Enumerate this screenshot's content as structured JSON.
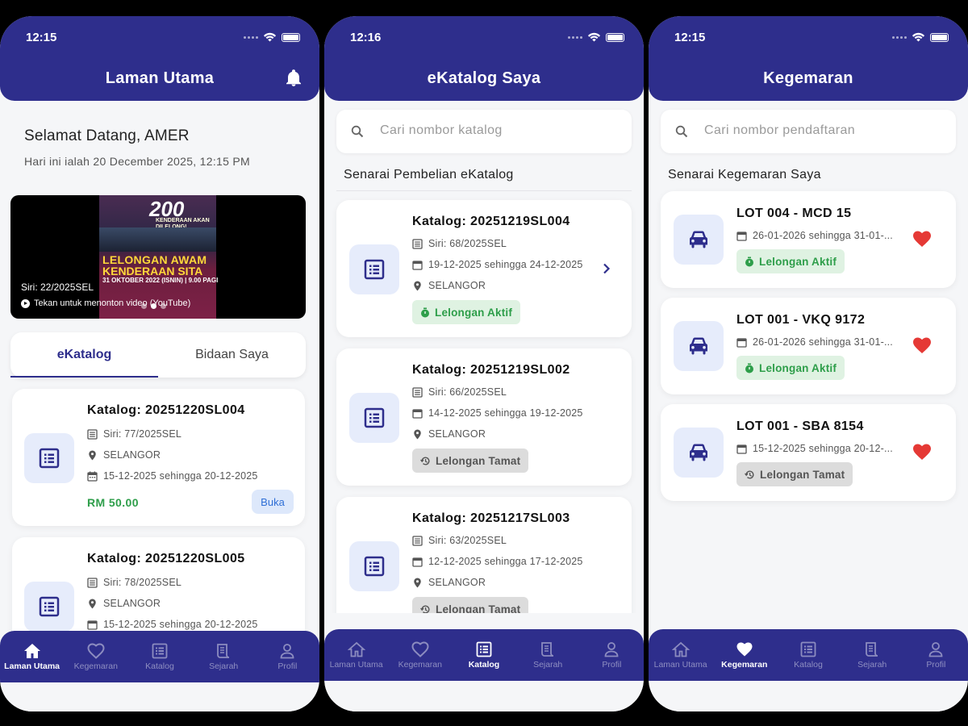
{
  "colors": {
    "primary": "#2e2e8c",
    "active_green": "#2e9e4a",
    "heart_red": "#e53935",
    "tile_bg": "#e6ecfb"
  },
  "home": {
    "status_time": "12:15",
    "title": "Laman Utama",
    "greeting": "Selamat Datang, AMER",
    "date_line": "Hari ini ialah 20 December 2025, 12:15 PM",
    "banner": {
      "poster_number": "200",
      "poster_tagline": "KENDERAAN AKAN DILELONG!",
      "poster_line1": "LELONGAN AWAM",
      "poster_line2": "KENDERAAN SITA",
      "poster_date": "31 OKTOBER 2022 (ISNIN) | 9.00 PAGI",
      "siri": "Siri: 22/2025SEL",
      "watch_text": "Tekan untuk menonton video (YouTube)"
    },
    "tabs": [
      "eKatalog",
      "Bidaan Saya"
    ],
    "cards": [
      {
        "title": "Katalog: 20251220SL004",
        "siri": "Siri: 77/2025SEL",
        "location": "SELANGOR",
        "dates": "15-12-2025 sehingga 20-12-2025",
        "price": "RM 50.00",
        "button": "Buka"
      },
      {
        "title": "Katalog: 20251220SL005",
        "siri": "Siri: 78/2025SEL",
        "location": "SELANGOR",
        "dates": "15-12-2025 sehingga 20-12-2025"
      }
    ]
  },
  "ekatalog": {
    "status_time": "12:16",
    "title": "eKatalog Saya",
    "search_placeholder": "Cari nombor katalog",
    "section_title": "Senarai Pembelian eKatalog",
    "cards": [
      {
        "title": "Katalog: 20251219SL004",
        "siri": "Siri: 68/2025SEL",
        "dates": "19-12-2025 sehingga 24-12-2025",
        "location": "SELANGOR",
        "status": "Lelongan Aktif"
      },
      {
        "title": "Katalog: 20251219SL002",
        "siri": "Siri: 66/2025SEL",
        "dates": "14-12-2025 sehingga 19-12-2025",
        "location": "SELANGOR",
        "status": "Lelongan Tamat"
      },
      {
        "title": "Katalog: 20251217SL003",
        "siri": "Siri: 63/2025SEL",
        "dates": "12-12-2025 sehingga 17-12-2025",
        "location": "SELANGOR",
        "status": "Lelongan Tamat"
      }
    ]
  },
  "kegemaran": {
    "status_time": "12:15",
    "title": "Kegemaran",
    "search_placeholder": "Cari nombor pendaftaran",
    "section_title": "Senarai Kegemaran Saya",
    "cards": [
      {
        "title": "LOT 004 - MCD 15",
        "dates": "26-01-2026 sehingga 31-01-...",
        "status": "Lelongan Aktif"
      },
      {
        "title": "LOT 001 - VKQ 9172",
        "dates": "26-01-2026 sehingga 31-01-...",
        "status": "Lelongan Aktif"
      },
      {
        "title": "LOT 001 - SBA 8154",
        "dates": "15-12-2025 sehingga 20-12-...",
        "status": "Lelongan Tamat"
      }
    ]
  },
  "nav": [
    "Laman Utama",
    "Kegemaran",
    "Katalog",
    "Sejarah",
    "Profil"
  ],
  "icons": [
    "home-icon",
    "heart-icon",
    "catalog-icon",
    "history-icon",
    "profile-icon",
    "bell-icon",
    "search-icon",
    "calendar-icon",
    "location-icon",
    "timer-icon",
    "history-clock-icon",
    "car-icon",
    "chevron-right-icon"
  ]
}
